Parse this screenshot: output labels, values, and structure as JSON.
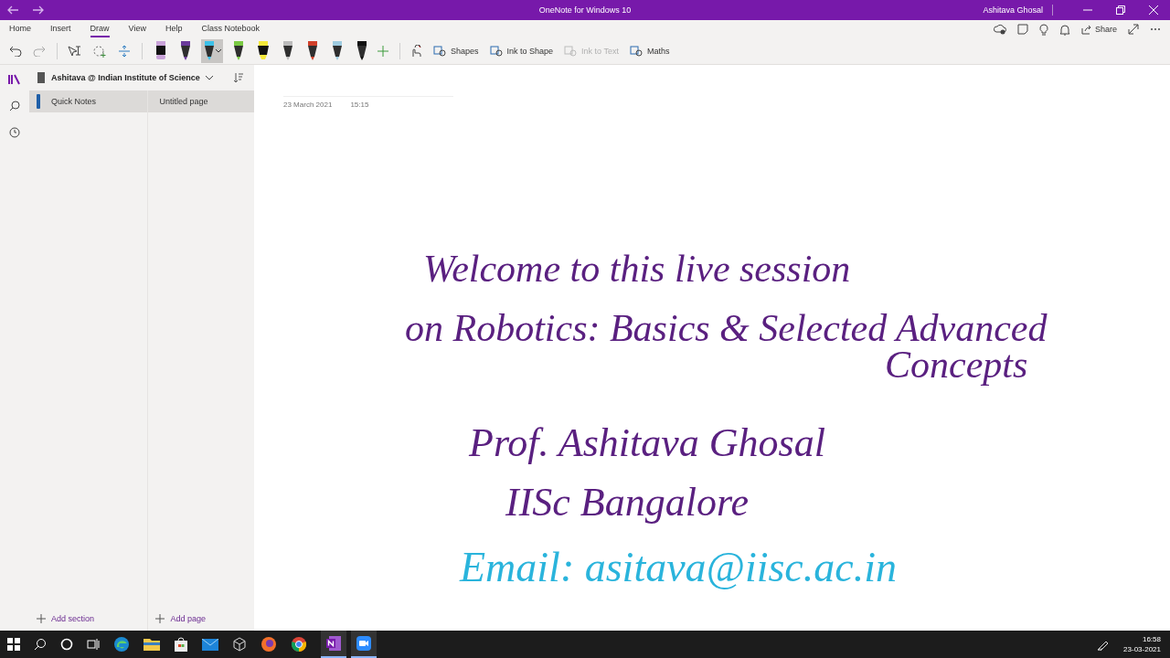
{
  "window": {
    "title": "OneNote for Windows 10",
    "user": "Ashitava Ghosal"
  },
  "ribbon_tabs": [
    {
      "label": "Home",
      "selected": false
    },
    {
      "label": "Insert",
      "selected": false
    },
    {
      "label": "Draw",
      "selected": true
    },
    {
      "label": "View",
      "selected": false
    },
    {
      "label": "Help",
      "selected": false
    },
    {
      "label": "Class Notebook",
      "selected": false
    }
  ],
  "pens": [
    {
      "color": "#c8a2d8",
      "kind": "marker",
      "selected": false
    },
    {
      "color": "#6a3a9a",
      "kind": "pen",
      "selected": false
    },
    {
      "color": "#3cc0e8",
      "kind": "pen",
      "selected": true
    },
    {
      "color": "#7ac943",
      "kind": "pen",
      "selected": false
    },
    {
      "color": "#f5e93a",
      "kind": "highlighter",
      "selected": false
    },
    {
      "color": "#bbbbbb",
      "kind": "pen",
      "selected": false
    },
    {
      "color": "#d0402a",
      "kind": "pen",
      "selected": false
    },
    {
      "color": "#9ecbe0",
      "kind": "pen",
      "selected": false
    },
    {
      "color": "#111111",
      "kind": "pen",
      "selected": false
    }
  ],
  "tools": [
    {
      "label": "Shapes",
      "disabled": false
    },
    {
      "label": "Ink to Shape",
      "disabled": false
    },
    {
      "label": "Ink to Text",
      "disabled": true
    },
    {
      "label": "Maths",
      "disabled": false
    }
  ],
  "share": "Share",
  "notebook": "Ashitava @ Indian Institute of Science",
  "sections": [
    {
      "label": "Quick Notes",
      "selected": true,
      "color": "#1f5fa8"
    }
  ],
  "pages": [
    {
      "label": "Untitled page",
      "selected": true
    }
  ],
  "add_section": "Add section",
  "add_page": "Add page",
  "page": {
    "date": "23 March 2021",
    "time": "15:15",
    "ink": [
      {
        "text": "Welcome to this live session",
        "color": "#5a2080"
      },
      {
        "text": "on Robotics: Basics & Selected Advanced",
        "color": "#5a2080"
      },
      {
        "text": "Concepts",
        "color": "#5a2080"
      },
      {
        "text": "Prof. Ashitava Ghosal",
        "color": "#5a2080"
      },
      {
        "text": "IISc Bangalore",
        "color": "#5a2080"
      },
      {
        "text": "Email: asitava@iisc.ac.in",
        "color": "#2ab4dc"
      }
    ]
  },
  "taskbar": {
    "time": "16:58",
    "date": "23-03-2021"
  }
}
